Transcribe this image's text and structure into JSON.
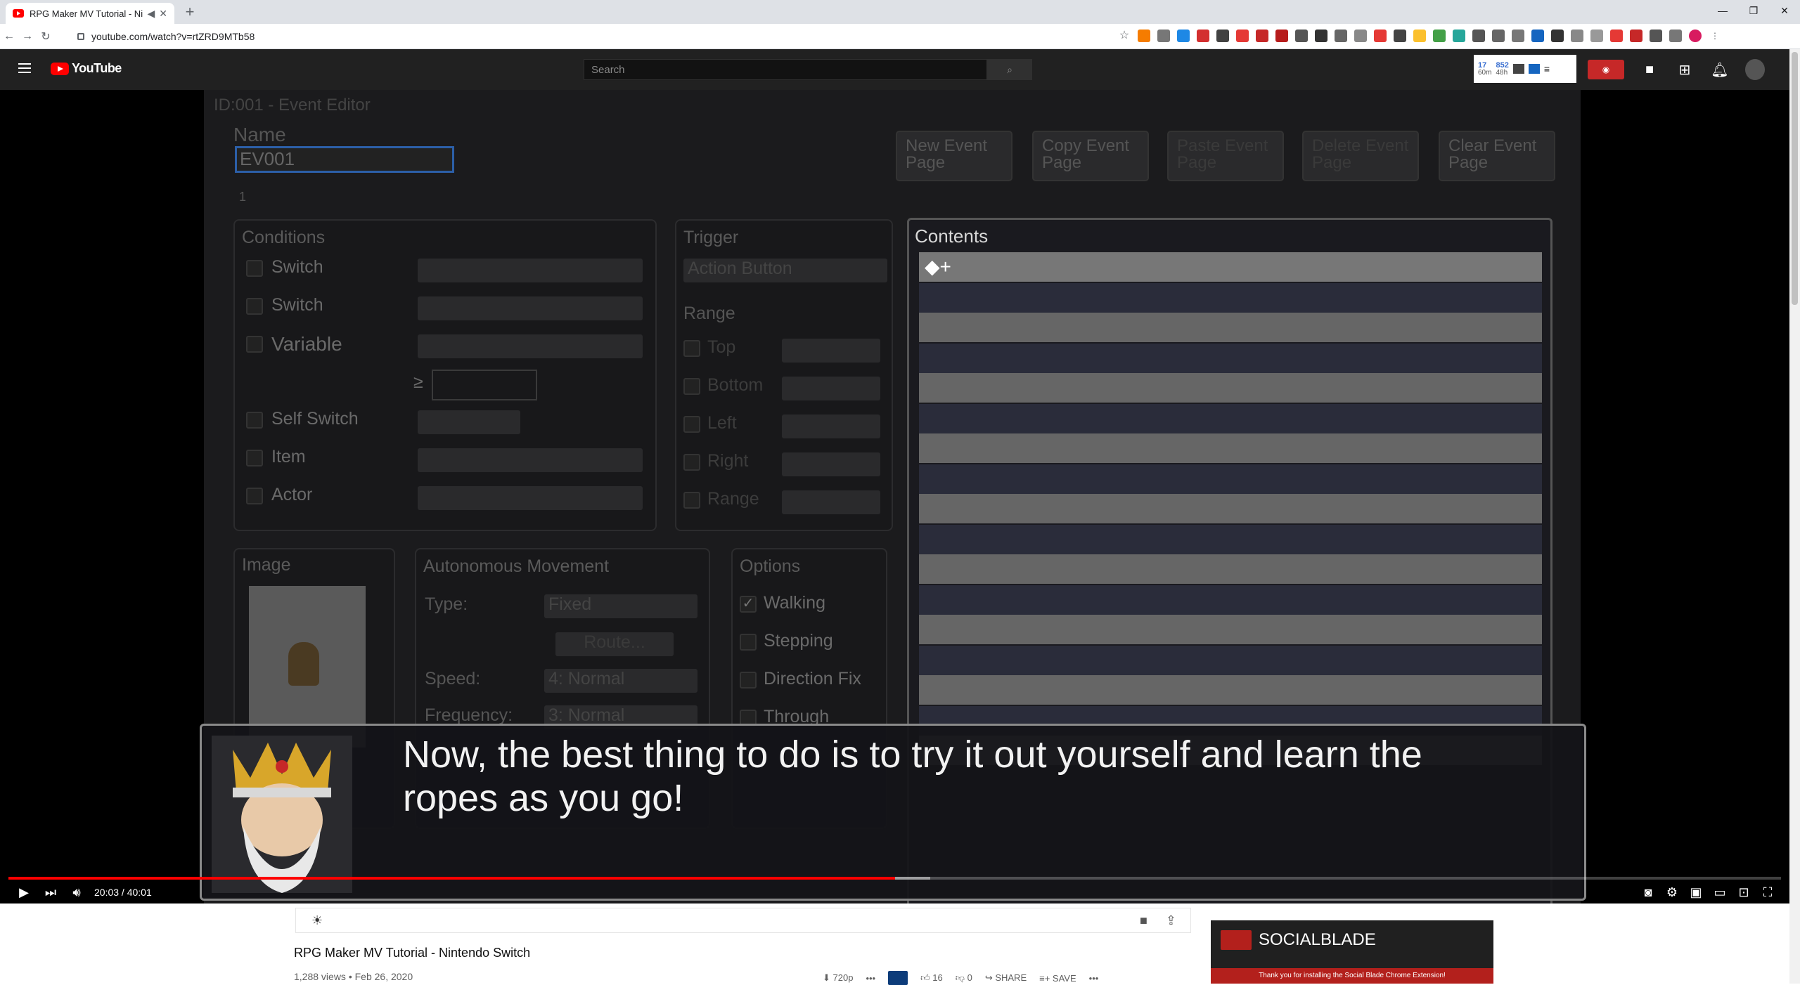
{
  "browser": {
    "tab_title": "RPG Maker MV Tutorial - Ni",
    "url": "youtube.com/watch?v=rtZRD9MTb58"
  },
  "masthead": {
    "logo_text": "YouTube",
    "search_placeholder": "Search",
    "sb_stat1": "17",
    "sb_stat1_sub": "60m",
    "sb_stat2": "852",
    "sb_stat2_sub": "48h"
  },
  "editor": {
    "title": "ID:001 - Event Editor",
    "name_label": "Name",
    "name_value": "EV001",
    "page_tab": "1",
    "buttons": [
      "New Event Page",
      "Copy Event Page",
      "Paste Event Page",
      "Delete Event Page",
      "Clear Event Page"
    ],
    "conditions_label": "Conditions",
    "conditions": [
      "Switch",
      "Switch",
      "Variable",
      "Self Switch",
      "Item",
      "Actor"
    ],
    "ge_symbol": "≥",
    "trigger_label": "Trigger",
    "trigger_value": "Action Button",
    "range_label": "Range",
    "range_items": [
      "Top",
      "Bottom",
      "Left",
      "Right",
      "Range"
    ],
    "contents_label": "Contents",
    "contents_first": "◆+",
    "image_label": "Image",
    "movement_label": "Autonomous Movement",
    "type_label": "Type:",
    "type_value": "Fixed",
    "route_label": "Route...",
    "speed_label": "Speed:",
    "speed_value": "4: Normal",
    "frequency_label": "Frequency:",
    "frequency_value": "3: Normal",
    "options_label": "Options",
    "options": [
      "Walking",
      "Stepping",
      "Direction Fix",
      "Through"
    ]
  },
  "dialog": {
    "text": "Now, the best thing to do is to try it out yourself and learn the ropes as you go!"
  },
  "player": {
    "time": "20:03 / 40:01",
    "progress_fraction": 0.5,
    "buffered_fraction": 0.52
  },
  "video_info": {
    "title": "RPG Maker MV Tutorial - Nintendo Switch",
    "meta": "1,288 views • Feb 26, 2020",
    "quality": "720p",
    "likes": "16",
    "dislikes": "0",
    "share": "SHARE",
    "save": "SAVE"
  },
  "socialblade": {
    "name": "SOCIALBLADE",
    "message": "Thank you for installing the Social Blade Chrome Extension!"
  }
}
